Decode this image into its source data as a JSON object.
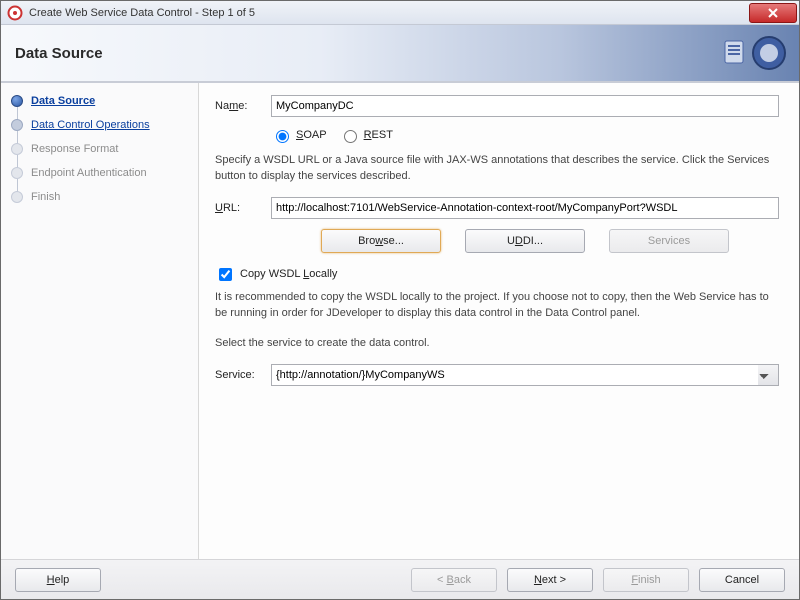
{
  "window": {
    "title": "Create Web Service Data Control - Step 1 of 5"
  },
  "banner": {
    "heading": "Data Source"
  },
  "sidebar": {
    "steps": [
      {
        "label": "Data Source",
        "state": "active"
      },
      {
        "label": "Data Control Operations",
        "state": "link"
      },
      {
        "label": "Response Format",
        "state": "pending"
      },
      {
        "label": "Endpoint Authentication",
        "state": "pending"
      },
      {
        "label": "Finish",
        "state": "pending"
      }
    ]
  },
  "form": {
    "name_label_pre": "Na",
    "name_label_u": "m",
    "name_label_post": "e:",
    "name_value": "MyCompanyDC",
    "soap_pre": "",
    "soap_u": "S",
    "soap_post": "OAP",
    "rest_pre": "",
    "rest_u": "R",
    "rest_post": "EST",
    "mode": "soap",
    "description1": "Specify a WSDL URL or a Java source file with JAX-WS annotations that describes the service. Click the Services button to display the services described.",
    "url_label_pre": "",
    "url_label_u": "U",
    "url_label_post": "RL:",
    "url_value": "http://localhost:7101/WebService-Annotation-context-root/MyCompanyPort?WSDL",
    "browse_label_pre": "Bro",
    "browse_label_u": "w",
    "browse_label_post": "se...",
    "uddi_label_pre": "U",
    "uddi_label_u": "D",
    "uddi_label_post": "DI...",
    "services_label": "Services",
    "copy_wsdl_checked": true,
    "copy_wsdl_pre": "Copy WSDL ",
    "copy_wsdl_u": "L",
    "copy_wsdl_post": "ocally",
    "copy_hint": "It is recommended to copy the WSDL locally to the project. If you choose not to copy, then the Web Service has to be running in order for JDeveloper to display this data control in the Data Control panel.",
    "select_service_hint": "Select the service to create the data control.",
    "service_label": "Service:",
    "service_value": "{http://annotation/}MyCompanyWS"
  },
  "footer": {
    "help_u": "H",
    "help_post": "elp",
    "back_pre": "< ",
    "back_u": "B",
    "back_post": "ack",
    "next_u": "N",
    "next_post": "ext >",
    "finish_u": "F",
    "finish_post": "inish",
    "cancel": "Cancel"
  }
}
